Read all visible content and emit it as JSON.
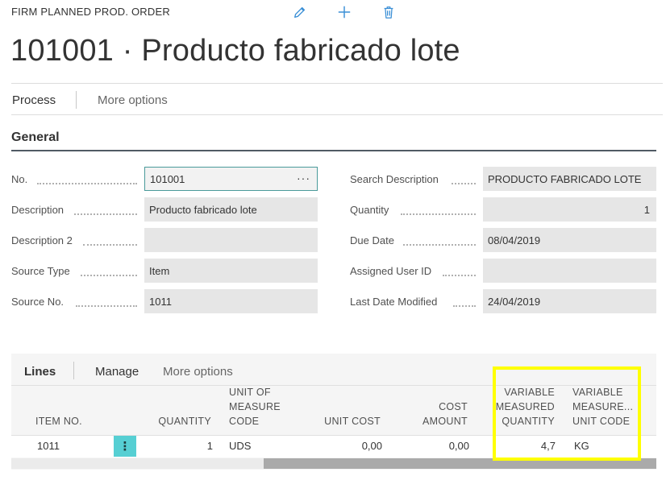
{
  "header": {
    "caption": "FIRM PLANNED PROD. ORDER",
    "title": "101001 · Producto fabricado lote",
    "icons": [
      "edit-icon",
      "add-icon",
      "delete-icon"
    ]
  },
  "actions": {
    "process": "Process",
    "more_options": "More options"
  },
  "general": {
    "title": "General",
    "left_fields": [
      {
        "label": "No.",
        "value": "101001"
      },
      {
        "label": "Description",
        "value": "Producto fabricado lote"
      },
      {
        "label": "Description 2",
        "value": ""
      },
      {
        "label": "Source Type",
        "value": "Item"
      },
      {
        "label": "Source No.",
        "value": "1011"
      }
    ],
    "right_fields": [
      {
        "label": "Search Description",
        "value": "PRODUCTO FABRICADO LOTE"
      },
      {
        "label": "Quantity",
        "value": "1"
      },
      {
        "label": "Due Date",
        "value": "08/04/2019"
      },
      {
        "label": "Assigned User ID",
        "value": ""
      },
      {
        "label": "Last Date Modified",
        "value": "24/04/2019"
      }
    ],
    "lookup_glyph": "···"
  },
  "lines": {
    "title": "Lines",
    "manage": "Manage",
    "more_options": "More options",
    "columns": {
      "item_no": "ITEM NO.",
      "quantity": "QUANTITY",
      "uom_1": "UNIT OF",
      "uom_2": "MEASURE",
      "uom_3": "CODE",
      "unit_cost": "UNIT COST",
      "cost_1": "COST",
      "cost_2": "AMOUNT",
      "vmq_1": "VARIABLE",
      "vmq_2": "MEASURED",
      "vmq_3": "QUANTITY",
      "vmu_1": "VARIABLE",
      "vmu_2": "MEASURE...",
      "vmu_3": "UNIT CODE"
    },
    "rows": [
      {
        "item_no": "1011",
        "menu_glyph": "⋮",
        "quantity": "1",
        "uom": "UDS",
        "unit_cost": "0,00",
        "cost_amount": "0,00",
        "variable_measured_quantity": "4,7",
        "variable_measure_unit_code": "KG"
      }
    ],
    "scroll_position": 0.4
  },
  "colors": {
    "accent": "#56cfd3",
    "focus_border": "#4a9a9a",
    "highlight": "#ffff00",
    "title_rule": "#505a64"
  }
}
